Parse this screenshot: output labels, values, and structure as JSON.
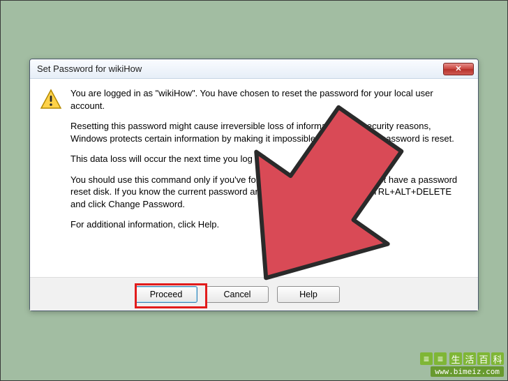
{
  "dialog": {
    "title": "Set Password for wikiHow",
    "close_label": "X",
    "paragraphs": {
      "p1": "You are logged in as \"wikiHow\". You have chosen to reset the password for your local user account.",
      "p2": "Resetting this password might cause irreversible loss of information. For security reasons, Windows protects certain information by making it impossible to access if the password is reset.",
      "p3": "This data loss will occur the next time you log off.",
      "p4": "You should use this command only if you've forgotten the password and do not have a password reset disk. If you know the current password and want to change it, press CTRL+ALT+DELETE and click Change Password.",
      "p5": "For additional information, click Help."
    },
    "buttons": {
      "proceed": "Proceed",
      "cancel": "Cancel",
      "help": "Help"
    }
  },
  "watermark": {
    "chars": [
      "生",
      "活",
      "百",
      "科"
    ],
    "url": "www.bimeiz.com"
  }
}
